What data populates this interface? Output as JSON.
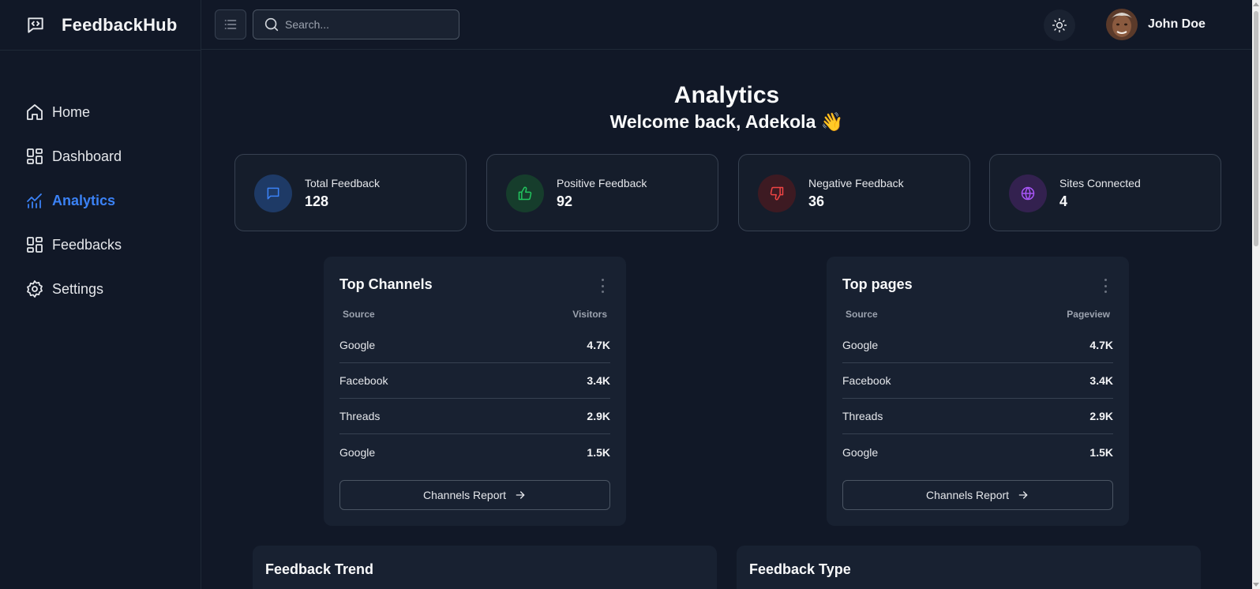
{
  "app": {
    "name": "FeedbackHub"
  },
  "sidebar": {
    "items": [
      {
        "label": "Home",
        "icon": "home-icon",
        "active": false
      },
      {
        "label": "Dashboard",
        "icon": "dashboard-icon",
        "active": false
      },
      {
        "label": "Analytics",
        "icon": "analytics-icon",
        "active": true
      },
      {
        "label": "Feedbacks",
        "icon": "feedbacks-icon",
        "active": false
      },
      {
        "label": "Settings",
        "icon": "settings-icon",
        "active": false
      }
    ]
  },
  "header": {
    "search_placeholder": "Search...",
    "user_name": "John Doe",
    "theme_icon": "sun-icon"
  },
  "main": {
    "title": "Analytics",
    "subtitle": "Welcome back, Adekola 👋",
    "stats": [
      {
        "label": "Total Feedback",
        "value": "128",
        "icon": "message-icon",
        "color": "#3b82f6"
      },
      {
        "label": "Positive Feedback",
        "value": "92",
        "icon": "thumbs-up-icon",
        "color": "#22c55e"
      },
      {
        "label": "Negative Feedback",
        "value": "36",
        "icon": "thumbs-down-icon",
        "color": "#ef4444"
      },
      {
        "label": "Sites Connected",
        "value": "4",
        "icon": "globe-icon",
        "color": "#a855f7"
      }
    ],
    "top_channels": {
      "title": "Top Channels",
      "col_source": "Source",
      "col_value": "Visitors",
      "rows": [
        {
          "source": "Google",
          "value": "4.7K"
        },
        {
          "source": "Facebook",
          "value": "3.4K"
        },
        {
          "source": "Threads",
          "value": "2.9K"
        },
        {
          "source": "Google",
          "value": "1.5K"
        }
      ],
      "button": "Channels Report"
    },
    "top_pages": {
      "title": "Top pages",
      "col_source": "Source",
      "col_value": "Pageview",
      "rows": [
        {
          "source": "Google",
          "value": "4.7K"
        },
        {
          "source": "Facebook",
          "value": "3.4K"
        },
        {
          "source": "Threads",
          "value": "2.9K"
        },
        {
          "source": "Google",
          "value": "1.5K"
        }
      ],
      "button": "Channels Report"
    },
    "feedback_trend": {
      "title": "Feedback Trend"
    },
    "feedback_type": {
      "title": "Feedback Type"
    }
  },
  "colors": {
    "background": "#111827",
    "accent": "#3b82f6",
    "card": "#182131"
  }
}
